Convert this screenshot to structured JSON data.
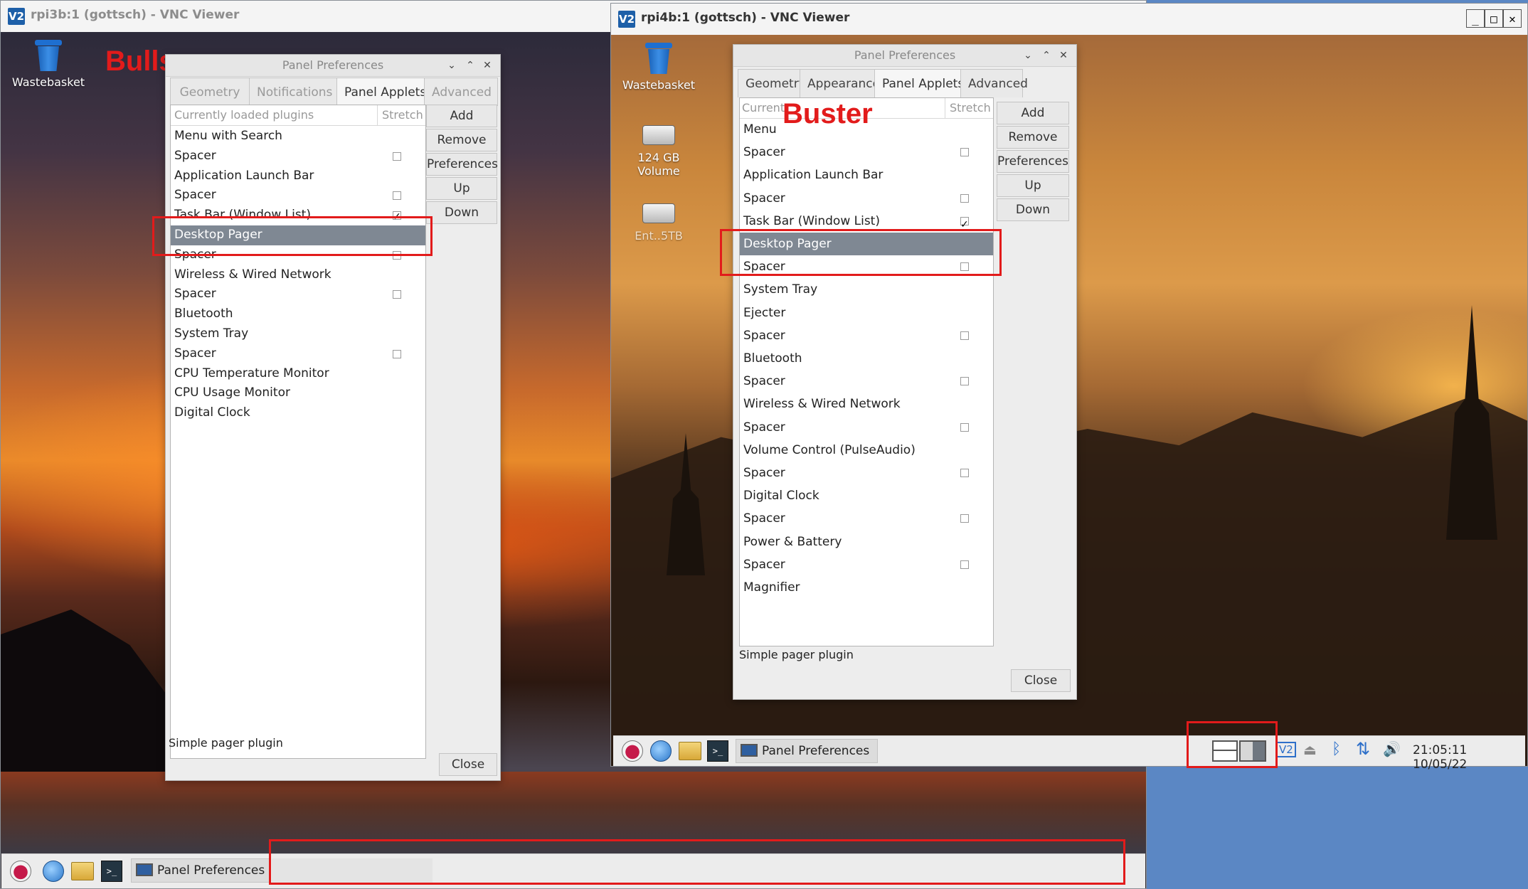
{
  "window1": {
    "title": "rpi3b:1 (gottsch) - VNC Viewer",
    "logo": "V2"
  },
  "window2": {
    "title": "rpi4b:1 (gottsch) - VNC Viewer",
    "logo": "V2",
    "controls": [
      "_",
      "□",
      "✕"
    ]
  },
  "annotations": {
    "left": "Bullseye",
    "right": "Buster"
  },
  "desktop1": {
    "wastebasket": "Wastebasket"
  },
  "desktop2": {
    "wastebasket": "Wastebasket",
    "volume": "124 GB Volume",
    "drive2": "Ent..5TB"
  },
  "dialog1": {
    "title": "Panel Preferences",
    "controls": [
      "⌄",
      "⌃",
      "✕"
    ],
    "tabs": [
      "Geometry",
      "Notifications",
      "Panel Applets",
      "Advanced"
    ],
    "active_tab": "Panel Applets",
    "col_plugins": "Currently loaded plugins",
    "col_stretch": "Stretch",
    "rows": [
      {
        "label": "Menu with Search",
        "cb": ""
      },
      {
        "label": "Spacer",
        "cb": "empty"
      },
      {
        "label": "Application Launch Bar",
        "cb": ""
      },
      {
        "label": "Spacer",
        "cb": "empty"
      },
      {
        "label": "Task Bar (Window List)",
        "cb": "checked"
      },
      {
        "label": "Desktop Pager",
        "cb": "",
        "selected": true
      },
      {
        "label": "Spacer",
        "cb": "empty"
      },
      {
        "label": "Wireless & Wired Network",
        "cb": ""
      },
      {
        "label": "Spacer",
        "cb": "empty"
      },
      {
        "label": "Bluetooth",
        "cb": ""
      },
      {
        "label": "System Tray",
        "cb": ""
      },
      {
        "label": "Spacer",
        "cb": "empty"
      },
      {
        "label": "CPU Temperature Monitor",
        "cb": ""
      },
      {
        "label": "CPU Usage Monitor",
        "cb": ""
      },
      {
        "label": "Digital Clock",
        "cb": ""
      }
    ],
    "buttons": [
      "Add",
      "Remove",
      "Preferences",
      "Up",
      "Down"
    ],
    "status": "Simple pager plugin",
    "close": "Close"
  },
  "dialog2": {
    "title": "Panel Preferences",
    "controls": [
      "⌄",
      "⌃",
      "✕"
    ],
    "tabs": [
      "Geometry",
      "Appearance",
      "Panel Applets",
      "Advanced"
    ],
    "active_tab": "Panel Applets",
    "col_plugins": "Current",
    "col_stretch": "Stretch",
    "rows": [
      {
        "label": "Menu",
        "cb": ""
      },
      {
        "label": "Spacer",
        "cb": "empty"
      },
      {
        "label": "Application Launch Bar",
        "cb": ""
      },
      {
        "label": "Spacer",
        "cb": "empty"
      },
      {
        "label": "Task Bar (Window List)",
        "cb": "checked"
      },
      {
        "label": "Desktop Pager",
        "cb": "",
        "selected": true
      },
      {
        "label": "Spacer",
        "cb": "empty"
      },
      {
        "label": "System Tray",
        "cb": ""
      },
      {
        "label": "Ejecter",
        "cb": ""
      },
      {
        "label": "Spacer",
        "cb": "empty"
      },
      {
        "label": "Bluetooth",
        "cb": ""
      },
      {
        "label": "Spacer",
        "cb": "empty"
      },
      {
        "label": "Wireless & Wired Network",
        "cb": ""
      },
      {
        "label": "Spacer",
        "cb": "empty"
      },
      {
        "label": "Volume Control (PulseAudio)",
        "cb": ""
      },
      {
        "label": "Spacer",
        "cb": "empty"
      },
      {
        "label": "Digital Clock",
        "cb": ""
      },
      {
        "label": "Spacer",
        "cb": "empty"
      },
      {
        "label": "Power & Battery",
        "cb": ""
      },
      {
        "label": "Spacer",
        "cb": "empty"
      },
      {
        "label": "Magnifier",
        "cb": ""
      }
    ],
    "buttons": [
      "Add",
      "Remove",
      "Preferences",
      "Up",
      "Down"
    ],
    "status": "Simple pager plugin",
    "close": "Close"
  },
  "taskbar1": {
    "task": "Panel Preferences",
    "icons": [
      "raspberry-icon",
      "globe-icon",
      "folder-icon",
      "terminal-icon"
    ]
  },
  "taskbar2": {
    "task": "Panel Preferences",
    "icons": [
      "raspberry-icon",
      "globe-icon",
      "folder-icon",
      "terminal-icon"
    ],
    "clock": "21:05:11 10/05/22",
    "tray": [
      "vnc-icon",
      "eject-icon",
      "bluetooth-icon",
      "network-icon",
      "volume-icon"
    ],
    "terminal_glyph": ">_",
    "vnc_glyph": "V2",
    "eject_glyph": "⏏",
    "bluetooth_glyph": "ᛒ",
    "network_glyph": "⇅",
    "volume_glyph": "🔊"
  },
  "colors": {
    "annotation_red": "#e21b1b",
    "selection": "#7f8893"
  }
}
